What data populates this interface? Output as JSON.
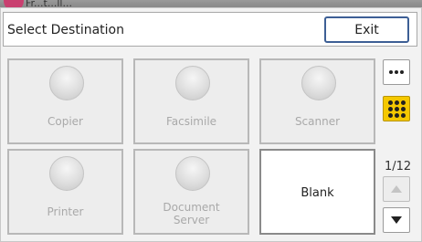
{
  "background_app": {
    "partial_title": "Fr...t...ll..."
  },
  "dialog": {
    "title": "Select Destination",
    "exit_label": "Exit"
  },
  "destinations": [
    {
      "label_line1": "Copier",
      "label_line2": "",
      "enabled": false
    },
    {
      "label_line1": "Facsimile",
      "label_line2": "",
      "enabled": false
    },
    {
      "label_line1": "Scanner",
      "label_line2": "",
      "enabled": false
    },
    {
      "label_line1": "Printer",
      "label_line2": "",
      "enabled": false
    },
    {
      "label_line1": "Document",
      "label_line2": "Server",
      "enabled": false
    },
    {
      "label_line1": "Blank",
      "label_line2": "",
      "enabled": true
    }
  ],
  "side": {
    "more_icon": "ellipsis-icon",
    "grid_icon": "grid-dots-icon",
    "grid_selected_color": "#f5c800",
    "page_indicator": "1/12",
    "page_up_icon": "arrow-up-icon",
    "page_down_icon": "arrow-down-icon"
  }
}
